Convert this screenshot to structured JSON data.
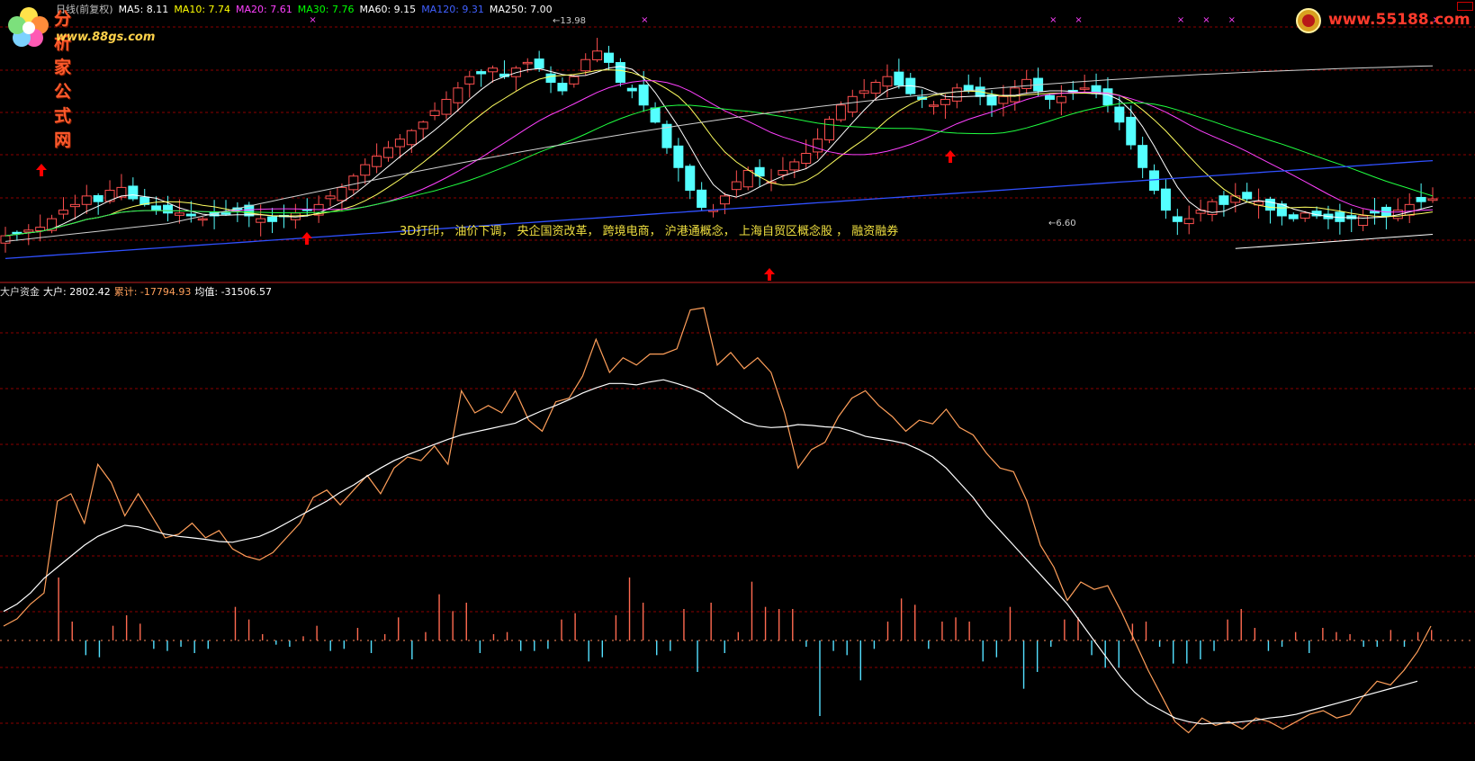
{
  "header": {
    "title_text": "日线(前复权)",
    "ma_items": [
      {
        "label": "MA5:",
        "value": "8.11",
        "color": "#ffffff"
      },
      {
        "label": "MA10:",
        "value": "7.74",
        "color": "#ffff00"
      },
      {
        "label": "MA20:",
        "value": "7.61",
        "color": "#ff40ff"
      },
      {
        "label": "MA30:",
        "value": "7.76",
        "color": "#00ff00"
      },
      {
        "label": "MA60:",
        "value": "9.15",
        "color": "#ffffff"
      },
      {
        "label": "MA120:",
        "value": "9.31",
        "color": "#4060ff"
      },
      {
        "label": "MA250:",
        "value": "7.00",
        "color": "#ffffff"
      }
    ]
  },
  "logos": {
    "left_brand": "分析家公式网",
    "left_url": "www.88gs.com",
    "right_url": "www.55188.com"
  },
  "concepts_text": "3D打印， 油价下调， 央企国资改革， 跨境电商， 沪港通概念， 上海自贸区概念股 ， 融资融券",
  "price_labels": {
    "high": "13.98",
    "low": "6.60"
  },
  "sub_header": {
    "name": "大户资金",
    "items": [
      {
        "label": "大户:",
        "value": "2802.42",
        "color": "#ffffff"
      },
      {
        "label": "累计:",
        "value": "-17794.93",
        "color": "#ff9f5a"
      },
      {
        "label": "均值:",
        "value": "-31506.57",
        "color": "#ffffff"
      }
    ]
  },
  "colors": {
    "up_candle": "#ff5050",
    "down_candle": "#54ffff",
    "cumulative_line": "#ff9f5a",
    "average_line": "#ffffff",
    "grid": "#8b0000",
    "divider": "#c02020",
    "signal_arrow": "#ff0000",
    "x_marker": "#ff40ff"
  },
  "chart_data": [
    {
      "type": "candlestick",
      "title": "",
      "ylim": [
        5.8,
        14.6
      ],
      "close_series_approx": [
        7.0,
        7.1,
        7.2,
        7.3,
        7.6,
        7.9,
        8.1,
        8.4,
        8.2,
        8.6,
        8.7,
        8.3,
        8.1,
        7.9,
        7.8,
        7.8,
        7.7,
        7.6,
        7.7,
        7.8,
        7.9,
        7.7,
        7.6,
        7.5,
        7.7,
        7.8,
        7.9,
        8.1,
        8.4,
        8.7,
        9.1,
        9.5,
        9.8,
        10.1,
        10.4,
        10.7,
        11.0,
        11.4,
        11.8,
        12.2,
        12.6,
        12.7,
        12.9,
        12.6,
        12.9,
        13.1,
        12.9,
        12.4,
        12.1,
        12.6,
        13.2,
        13.5,
        13.1,
        12.4,
        12.1,
        11.6,
        11.0,
        10.1,
        9.4,
        8.6,
        8.0,
        7.9,
        8.4,
        8.9,
        9.3,
        9.1,
        8.9,
        9.3,
        9.6,
        9.9,
        10.4,
        11.1,
        11.6,
        11.9,
        12.1,
        12.4,
        12.6,
        12.3,
        12.0,
        11.8,
        11.6,
        11.8,
        12.2,
        12.1,
        11.9,
        11.6,
        11.9,
        12.2,
        12.5,
        12.1,
        11.8,
        11.9,
        12.1,
        12.2,
        12.0,
        11.6,
        11.0,
        10.2,
        9.4,
        8.6,
        7.9,
        7.5,
        7.6,
        7.9,
        8.2,
        8.1,
        8.4,
        8.3,
        8.2,
        7.9,
        7.7,
        7.6,
        7.8,
        7.7,
        7.6,
        7.5,
        7.6,
        7.7,
        7.8,
        7.7,
        7.9,
        8.1,
        8.2,
        8.3
      ],
      "marker_x_count": 8,
      "signal_arrows_count": 4
    },
    {
      "type": "line",
      "title": "大户资金",
      "series": [
        {
          "name": "累计",
          "values": [
            -38000,
            -37000,
            -35000,
            -33500,
            -21000,
            -20000,
            -24000,
            -16000,
            -18500,
            -23000,
            -20000,
            -23000,
            -26000,
            -25500,
            -24000,
            -26000,
            -25000,
            -27500,
            -28500,
            -29000,
            -28000,
            -26000,
            -24000,
            -20500,
            -19500,
            -21500,
            -19500,
            -17500,
            -20000,
            -16500,
            -15000,
            -15500,
            -13500,
            -16000,
            -6000,
            -9000,
            -8000,
            -9000,
            -6000,
            -10000,
            -11500,
            -7500,
            -7000,
            -4000,
            1000,
            -3500,
            -1500,
            -2500,
            -1000,
            -1000,
            -300,
            5000,
            5300,
            -2500,
            -800,
            -3000,
            -1500,
            -3500,
            -9000,
            -16500,
            -14000,
            -13000,
            -9500,
            -7000,
            -6000,
            -8000,
            -9500,
            -11500,
            -10000,
            -10500,
            -8500,
            -11000,
            -12000,
            -14500,
            -16500,
            -17000,
            -21000,
            -27000,
            -30000,
            -34500,
            -32000,
            -33000,
            -32500,
            -36000,
            -40000,
            -44000,
            -47500,
            -51000,
            -52500,
            -50500,
            -51500,
            -51000,
            -52000,
            -50500,
            -51000,
            -52000,
            -51000,
            -50000,
            -49500,
            -50500,
            -50000,
            -47500,
            -45500,
            -46000,
            -44000,
            -41500,
            -38000
          ],
          "color": "#ff9f5a"
        },
        {
          "name": "均值",
          "values": [
            -36000,
            -35000,
            -33500,
            -31500,
            -30000,
            -28500,
            -27000,
            -25800,
            -25000,
            -24300,
            -24500,
            -25000,
            -25500,
            -25800,
            -26000,
            -26200,
            -26500,
            -26600,
            -26200,
            -25800,
            -25000,
            -24000,
            -23000,
            -22000,
            -21000,
            -19800,
            -18800,
            -17600,
            -16500,
            -15500,
            -14700,
            -14000,
            -13300,
            -12600,
            -12000,
            -11600,
            -11200,
            -10800,
            -10400,
            -9500,
            -8700,
            -8000,
            -7200,
            -6300,
            -5600,
            -5000,
            -5000,
            -5200,
            -4800,
            -4500,
            -5000,
            -5600,
            -6400,
            -7800,
            -9000,
            -10200,
            -10800,
            -11000,
            -10900,
            -10600,
            -10700,
            -10900,
            -11000,
            -11500,
            -12200,
            -12500,
            -12800,
            -13200,
            -14000,
            -15000,
            -16500,
            -18500,
            -20500,
            -23000,
            -25000,
            -27000,
            -29000,
            -31000,
            -33000,
            -35000,
            -37500,
            -40000,
            -42500,
            -45000,
            -47000,
            -48500,
            -49500,
            -50500,
            -51000,
            -51300,
            -51200,
            -51200,
            -51000,
            -50800,
            -50500,
            -50300,
            -50000,
            -49500,
            -49000,
            -48500,
            -48000,
            -47500,
            -47000,
            -46500,
            -46000,
            -45500
          ],
          "color": "#ffffff"
        }
      ],
      "bars_name": "大户",
      "bar_values": [
        0,
        0,
        0,
        0,
        3000,
        900,
        -700,
        -800,
        700,
        1200,
        800,
        -400,
        -500,
        -300,
        -600,
        -400,
        0,
        1600,
        1000,
        300,
        -200,
        -300,
        200,
        700,
        -500,
        -400,
        600,
        -600,
        300,
        1100,
        -900,
        400,
        2200,
        1400,
        1800,
        -600,
        300,
        400,
        -500,
        -500,
        -400,
        1000,
        1300,
        -1000,
        -800,
        1200,
        3000,
        1800,
        -700,
        -500,
        1500,
        -1500,
        1800,
        -600,
        400,
        2800,
        1600,
        1500,
        1500,
        -300,
        -3600,
        -500,
        -700,
        -1900,
        -400,
        900,
        2000,
        1700,
        -400,
        900,
        1100,
        900,
        -1000,
        -800,
        1600,
        -2300,
        -1500,
        -300,
        1000,
        1100,
        -700,
        -1300,
        -1300,
        800,
        900,
        -300,
        -1100,
        -1100,
        -900,
        -500,
        1000,
        1500,
        600,
        -500,
        -300,
        400,
        -600,
        600,
        400,
        300,
        -300,
        -300,
        500,
        -300,
        400,
        500
      ],
      "ylim": [
        -55000,
        8000
      ]
    }
  ]
}
